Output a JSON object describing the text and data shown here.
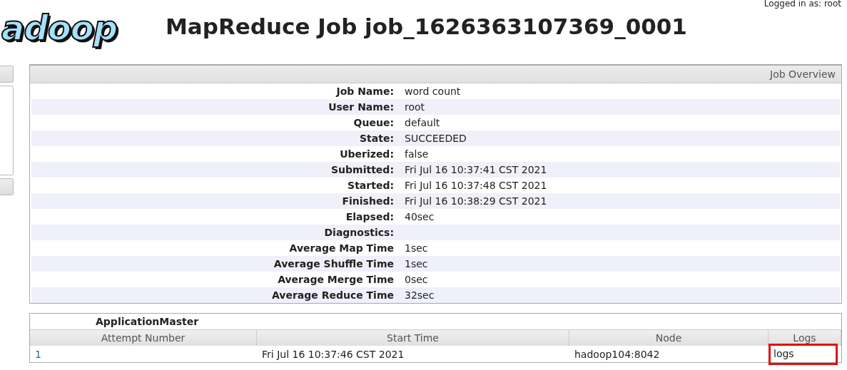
{
  "header": {
    "logo": "adoop",
    "title": "MapReduce Job job_1626363107369_0001",
    "login": "Logged in as: root"
  },
  "overview": {
    "caption": "Job Overview",
    "rows": [
      {
        "label": "Job Name:",
        "value": "word count"
      },
      {
        "label": "User Name:",
        "value": "root"
      },
      {
        "label": "Queue:",
        "value": "default"
      },
      {
        "label": "State:",
        "value": "SUCCEEDED"
      },
      {
        "label": "Uberized:",
        "value": "false"
      },
      {
        "label": "Submitted:",
        "value": "Fri Jul 16 10:37:41 CST 2021"
      },
      {
        "label": "Started:",
        "value": "Fri Jul 16 10:37:48 CST 2021"
      },
      {
        "label": "Finished:",
        "value": "Fri Jul 16 10:38:29 CST 2021"
      },
      {
        "label": "Elapsed:",
        "value": "40sec"
      },
      {
        "label": "Diagnostics:"
      },
      {
        "label": "Average Map Time",
        "value": "1sec"
      },
      {
        "label": "Average Shuffle Time",
        "value": "1sec"
      },
      {
        "label": "Average Merge Time",
        "value": "0sec"
      },
      {
        "label": "Average Reduce Time",
        "value": "32sec"
      }
    ]
  },
  "attempts": {
    "title": "ApplicationMaster",
    "columns": [
      "Attempt Number",
      "Start Time",
      "Node",
      "Logs"
    ],
    "rows": [
      {
        "cells": [
          {
            "text": "1",
            "kind": "link"
          },
          {
            "text": "Fri Jul 16 10:37:46 CST 2021",
            "kind": "text"
          },
          {
            "text": "hadoop104:8042",
            "kind": "text"
          },
          {
            "text": "logs",
            "kind": "marked"
          }
        ]
      }
    ]
  }
}
